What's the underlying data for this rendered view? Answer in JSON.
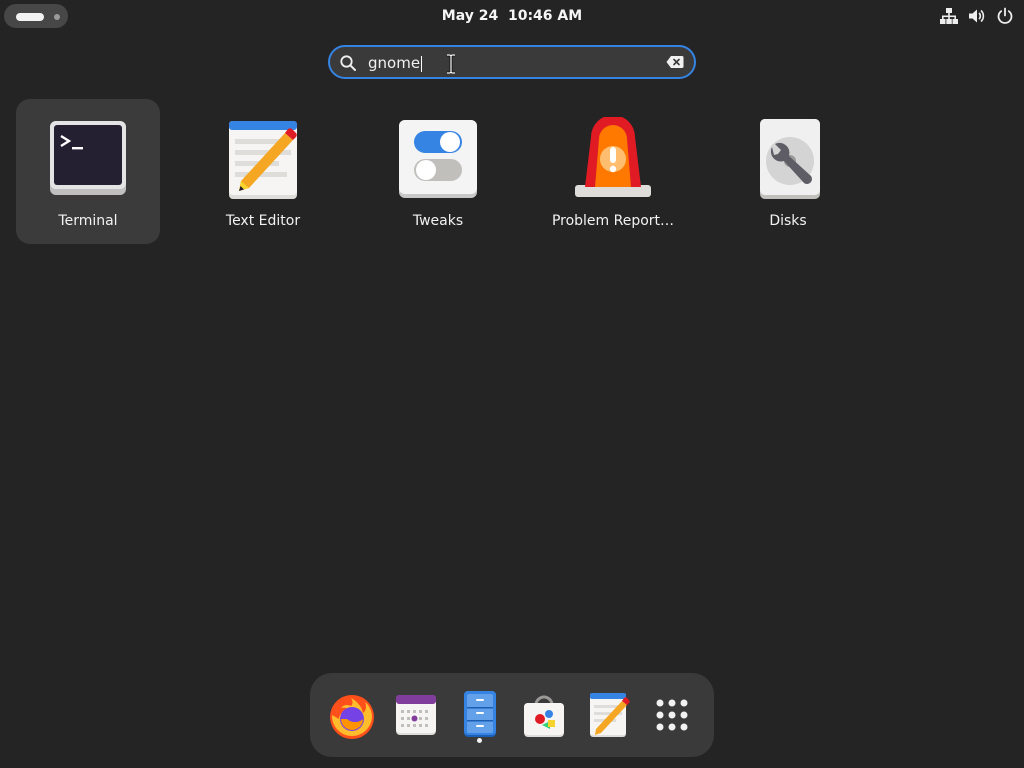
{
  "topbar": {
    "clock": "May 24  10:46 AM",
    "icons": [
      "network-wired-icon",
      "volume-icon",
      "power-icon"
    ]
  },
  "search": {
    "value": "gnome",
    "icons": [
      "search-icon",
      "clear-icon"
    ]
  },
  "results": [
    {
      "label": "Terminal",
      "icon": "terminal-icon",
      "selected": true
    },
    {
      "label": "Text Editor",
      "icon": "text-editor-icon",
      "selected": false
    },
    {
      "label": "Tweaks",
      "icon": "tweaks-icon",
      "selected": false
    },
    {
      "label": "Problem Report…",
      "icon": "problem-report-icon",
      "selected": false
    },
    {
      "label": "Disks",
      "icon": "disks-icon",
      "selected": false
    }
  ],
  "dock": {
    "items": [
      {
        "icon": "firefox-icon"
      },
      {
        "icon": "calendar-icon"
      },
      {
        "icon": "files-icon",
        "running": true
      },
      {
        "icon": "software-icon"
      },
      {
        "icon": "text-editor-icon"
      },
      {
        "icon": "show-apps-icon"
      }
    ]
  },
  "colors": {
    "background": "#242424",
    "accent": "#3584e4",
    "selected": "#3b3b3b"
  }
}
